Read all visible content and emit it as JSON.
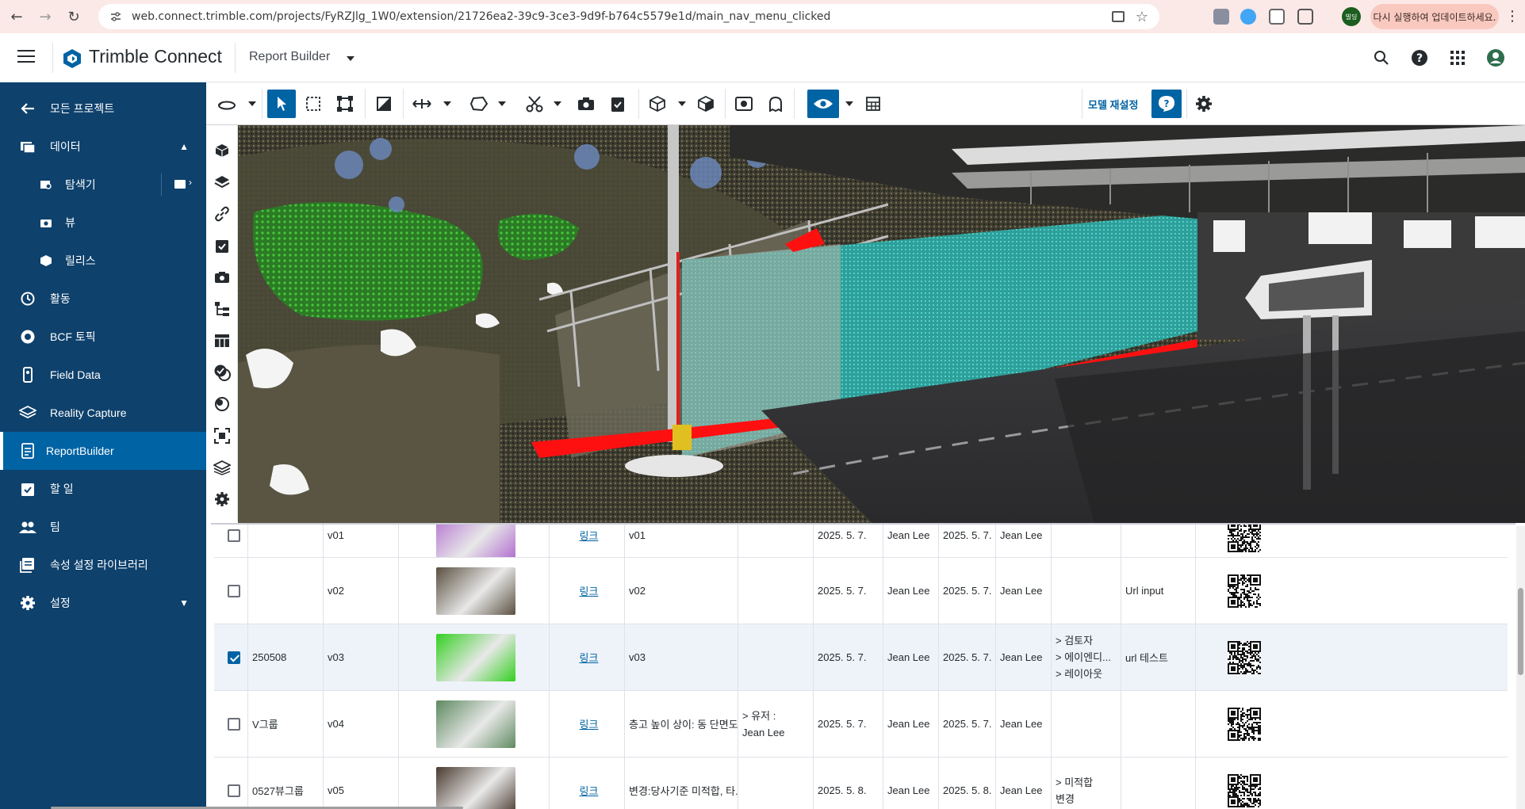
{
  "browser": {
    "url": "web.connect.trimble.com/projects/FyRZJlg_1W0/extension/21726ea2-39c9-3ce3-9d9f-b764c5579e1d/main_nav_menu_clicked",
    "profile_label": "빌딩",
    "update_label": "다시 실행하여 업데이트하세요."
  },
  "header": {
    "brand": "Trimble Connect",
    "module": "Report Builder"
  },
  "nav": {
    "back": "모든 프로젝트",
    "data": "데이터",
    "explorer": "탐색기",
    "view": "뷰",
    "release": "릴리스",
    "activity": "활동",
    "bcf": "BCF 토픽",
    "field_data": "Field Data",
    "reality_capture": "Reality Capture",
    "report_builder": "ReportBuilder",
    "todo": "할 일",
    "team": "팀",
    "property_library": "속성 설정 라이브러리",
    "settings": "설정"
  },
  "toolbar": {
    "reset_model": "모델 재설정"
  },
  "table": {
    "link_label": "링크",
    "rows": [
      {
        "checked": false,
        "group": "",
        "version": "v01",
        "desc": "v01",
        "note": "",
        "date1": "2025. 5. 7.",
        "user1": "Jean Lee",
        "date2": "2025. 5. 7.",
        "user2": "Jean Lee",
        "tags": [],
        "url": "",
        "thumb": "#b06cd0"
      },
      {
        "checked": false,
        "group": "",
        "version": "v02",
        "desc": "v02",
        "note": "",
        "date1": "2025. 5. 7.",
        "user1": "Jean Lee",
        "date2": "2025. 5. 7.",
        "user2": "Jean Lee",
        "tags": [],
        "url": "Url input",
        "thumb": "#5a5040"
      },
      {
        "checked": true,
        "group": "250508",
        "version": "v03",
        "desc": "v03",
        "note": "",
        "date1": "2025. 5. 7.",
        "user1": "Jean Lee",
        "date2": "2025. 5. 7.",
        "user2": "Jean Lee",
        "tags": [
          "> 검토자",
          "> 에이엔디...",
          "> 레이아웃"
        ],
        "url": "url 테스트",
        "thumb": "#33d020"
      },
      {
        "checked": false,
        "group": "V그룹",
        "version": "v04",
        "desc": "층고 높이 상이: 동 단면도...",
        "note": "> 유저 : \nJean Lee",
        "date1": "2025. 5. 7.",
        "user1": "Jean Lee",
        "date2": "2025. 5. 7.",
        "user2": "Jean Lee",
        "tags": [],
        "url": "",
        "thumb": "#5e8a60"
      },
      {
        "checked": false,
        "group": "0527뷰그룹",
        "version": "v05",
        "desc": "변경:당사기준 미적합, 타...",
        "note": "",
        "date1": "2025. 5. 8.",
        "user1": "Jean Lee",
        "date2": "2025. 5. 8.",
        "user2": "Jean Lee",
        "tags": [
          "> 미적합",
          "변경"
        ],
        "url": "",
        "thumb": "#4a3a30"
      }
    ]
  },
  "colors": {
    "nav_bg": "#0e416c",
    "nav_active": "#0063a3",
    "accent": "#0063a3"
  }
}
